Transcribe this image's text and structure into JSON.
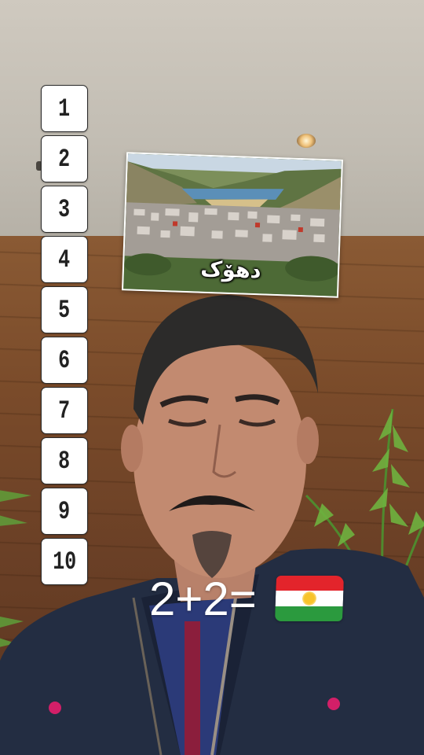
{
  "number_list": {
    "items": [
      "1",
      "2",
      "3",
      "4",
      "5",
      "6",
      "7",
      "8",
      "9",
      "10"
    ]
  },
  "city_card": {
    "caption": "دهۆک"
  },
  "equation": {
    "text": "2+2="
  },
  "flag": {
    "icon": "kurdistan-flag-icon",
    "colors": {
      "top": "#e3242b",
      "middle": "#ffffff",
      "bottom": "#2b9a3e",
      "sun": "#f7c32b"
    }
  }
}
